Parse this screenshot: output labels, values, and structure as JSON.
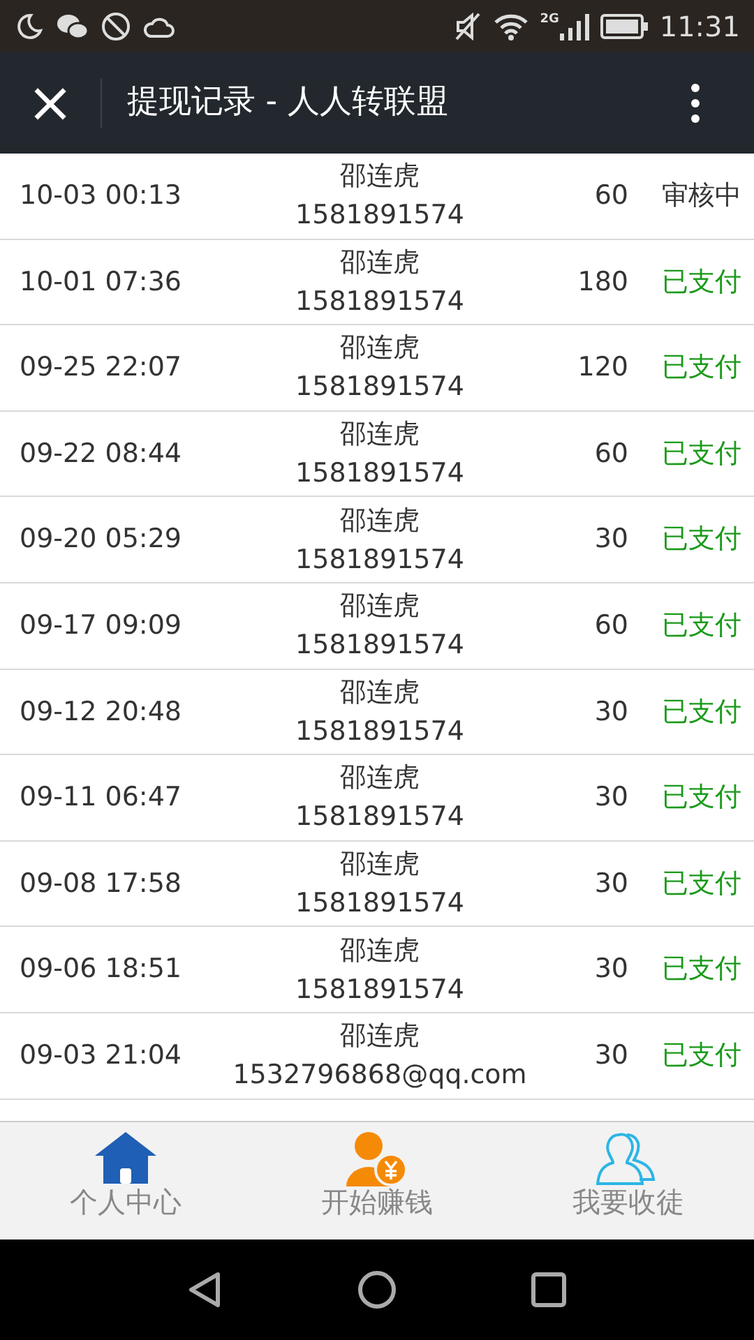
{
  "status_bar": {
    "network": "2G",
    "time": "11:31"
  },
  "header": {
    "close": "×",
    "title": "提现记录 - 人人转联盟"
  },
  "records": [
    {
      "time": "10-03 00:13",
      "name": "邵连虎",
      "account": "1581891574",
      "amount": "60",
      "status": "审核中",
      "kind": "pending"
    },
    {
      "time": "10-01 07:36",
      "name": "邵连虎",
      "account": "1581891574",
      "amount": "180",
      "status": "已支付",
      "kind": "paid"
    },
    {
      "time": "09-25 22:07",
      "name": "邵连虎",
      "account": "1581891574",
      "amount": "120",
      "status": "已支付",
      "kind": "paid"
    },
    {
      "time": "09-22 08:44",
      "name": "邵连虎",
      "account": "1581891574",
      "amount": "60",
      "status": "已支付",
      "kind": "paid"
    },
    {
      "time": "09-20 05:29",
      "name": "邵连虎",
      "account": "1581891574",
      "amount": "30",
      "status": "已支付",
      "kind": "paid"
    },
    {
      "time": "09-17 09:09",
      "name": "邵连虎",
      "account": "1581891574",
      "amount": "60",
      "status": "已支付",
      "kind": "paid"
    },
    {
      "time": "09-12 20:48",
      "name": "邵连虎",
      "account": "1581891574",
      "amount": "30",
      "status": "已支付",
      "kind": "paid"
    },
    {
      "time": "09-11 06:47",
      "name": "邵连虎",
      "account": "1581891574",
      "amount": "30",
      "status": "已支付",
      "kind": "paid"
    },
    {
      "time": "09-08 17:58",
      "name": "邵连虎",
      "account": "1581891574",
      "amount": "30",
      "status": "已支付",
      "kind": "paid"
    },
    {
      "time": "09-06 18:51",
      "name": "邵连虎",
      "account": "1581891574",
      "amount": "30",
      "status": "已支付",
      "kind": "paid"
    },
    {
      "time": "09-03 21:04",
      "name": "邵连虎",
      "account": "1532796868@qq.com",
      "amount": "30",
      "status": "已支付",
      "kind": "paid"
    }
  ],
  "tabs": [
    {
      "label": "个人中心",
      "kind": "home"
    },
    {
      "label": "开始赚钱",
      "kind": "earn"
    },
    {
      "label": "我要收徒",
      "kind": "recruit"
    }
  ]
}
